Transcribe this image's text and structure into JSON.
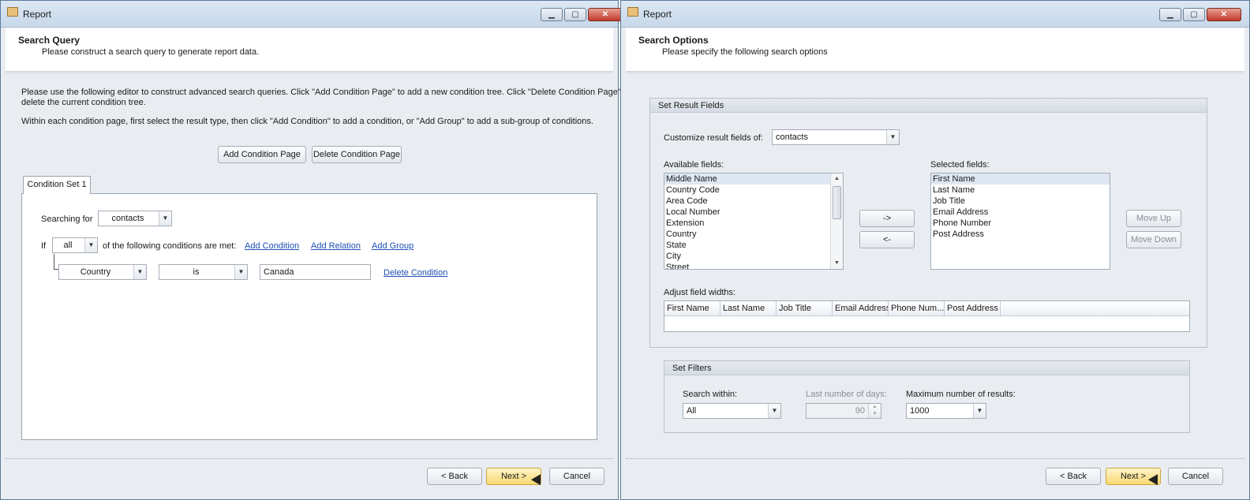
{
  "left": {
    "window_title": "Report",
    "header_title": "Search Query",
    "header_subtitle": "Please construct a search query to generate report data.",
    "instructions_1a": "Please use the following editor to construct advanced search queries.  Click \"Add Condition Page\" to add a new condition tree.  Click \"Delete Condition Page\" to",
    "instructions_1b": "delete the current condition tree.",
    "instructions_2": "Within each condition page, first select the result type, then click \"Add Condition\" to add a condition, or \"Add Group\" to add a sub-group of conditions.",
    "add_page_btn": "Add Condition Page",
    "delete_page_btn": "Delete Condition Page",
    "tab_label": "Condition Set 1",
    "searching_for_label": "Searching for",
    "searching_for_value": "contacts",
    "if_label": "If",
    "if_value": "all",
    "conditions_met_label": "of the following conditions are met:",
    "add_condition": "Add Condition",
    "add_relation": "Add Relation",
    "add_group": "Add Group",
    "cond_field": "Country",
    "cond_operator": "is",
    "cond_value": "Canada",
    "delete_condition": "Delete Condition",
    "back_btn": "< Back",
    "next_btn": "Next >",
    "cancel_btn": "Cancel"
  },
  "right": {
    "window_title": "Report",
    "header_title": "Search Options",
    "header_subtitle": "Please specify the following search options",
    "result_fields_group": "Set Result Fields",
    "customize_label": "Customize result fields of:",
    "customize_value": "contacts",
    "available_label": "Available fields:",
    "available_fields": [
      "Middle Name",
      "Country Code",
      "Area Code",
      "Local Number",
      "Extension",
      "Country",
      "State",
      "City",
      "Street"
    ],
    "selected_label": "Selected fields:",
    "selected_fields": [
      "First Name",
      "Last Name",
      "Job Title",
      "Email Address",
      "Phone Number",
      "Post Address"
    ],
    "add_arrow": "->",
    "remove_arrow": "<-",
    "move_up": "Move Up",
    "move_down": "Move Down",
    "adjust_label": "Adjust field widths:",
    "width_columns": [
      "First Name",
      "Last Name",
      "Job Title",
      "Email Address",
      "Phone Num...",
      "Post Address"
    ],
    "filters_group": "Set Filters",
    "search_within_label": "Search within:",
    "search_within_value": "All",
    "last_days_label": "Last number of days:",
    "last_days_value": "90",
    "max_results_label": "Maximum number of results:",
    "max_results_value": "1000",
    "back_btn": "< Back",
    "next_btn": "Next >",
    "cancel_btn": "Cancel"
  }
}
